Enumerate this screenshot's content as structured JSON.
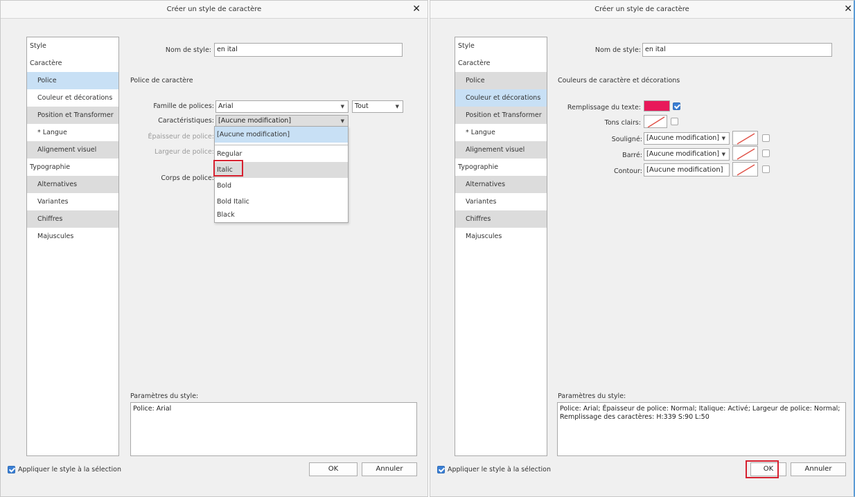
{
  "left_dialog": {
    "title": "Créer un style de caractère",
    "close_glyph": "✕",
    "sidebar": [
      {
        "label": "Style",
        "kind": "header"
      },
      {
        "label": "Caractère",
        "kind": "header"
      },
      {
        "label": "Police",
        "kind": "sub",
        "selected": true
      },
      {
        "label": "Couleur et décorations",
        "kind": "sub"
      },
      {
        "label": "Position et Transformer",
        "kind": "sub"
      },
      {
        "label": "* Langue",
        "kind": "sub"
      },
      {
        "label": "Alignement visuel",
        "kind": "sub"
      },
      {
        "label": "Typographie",
        "kind": "header"
      },
      {
        "label": "Alternatives",
        "kind": "sub"
      },
      {
        "label": "Variantes",
        "kind": "sub"
      },
      {
        "label": "Chiffres",
        "kind": "sub"
      },
      {
        "label": "Majuscules",
        "kind": "sub"
      }
    ],
    "style_name_label": "Nom de style:",
    "style_name_value": "en ital",
    "section_heading": "Police de caractère",
    "font_family_label": "Famille de polices:",
    "font_family_value": "Arial",
    "font_filter_value": "Tout",
    "characteristics_label": "Caractéristiques:",
    "characteristics_value": "[Aucune modification]",
    "weight_label": "Épaisseur de police:",
    "width_label": "Largeur de police:",
    "size_label": "Corps de police:",
    "dropdown_options": [
      "[Aucune modification]",
      "Regular",
      "Italic",
      "Bold",
      "Bold Italic",
      "Black"
    ],
    "dropdown_highlighted": "Italic",
    "params_label": "Paramètres du style:",
    "params_text": "Police: Arial",
    "apply_label": "Appliquer le style à la sélection",
    "ok_label": "OK",
    "cancel_label": "Annuler"
  },
  "right_dialog": {
    "title": "Créer un style de caractère",
    "close_glyph": "✕",
    "sidebar": [
      {
        "label": "Style",
        "kind": "header"
      },
      {
        "label": "Caractère",
        "kind": "header"
      },
      {
        "label": "Police",
        "kind": "sub"
      },
      {
        "label": "Couleur et décorations",
        "kind": "sub",
        "selected": true
      },
      {
        "label": "Position et Transformer",
        "kind": "sub"
      },
      {
        "label": "* Langue",
        "kind": "sub"
      },
      {
        "label": "Alignement visuel",
        "kind": "sub"
      },
      {
        "label": "Typographie",
        "kind": "header"
      },
      {
        "label": "Alternatives",
        "kind": "sub"
      },
      {
        "label": "Variantes",
        "kind": "sub"
      },
      {
        "label": "Chiffres",
        "kind": "sub"
      },
      {
        "label": "Majuscules",
        "kind": "sub"
      }
    ],
    "style_name_label": "Nom de style:",
    "style_name_value": "en ital",
    "section_heading": "Couleurs de caractère et décorations",
    "text_fill_label": "Remplissage du texte:",
    "text_fill_color": "#e8185a",
    "highlight_label": "Tons clairs:",
    "underline_label": "Souligné:",
    "underline_value": "[Aucune modification]",
    "strike_label": "Barré:",
    "strike_value": "[Aucune modification]",
    "outline_label": "Contour:",
    "outline_value": "[Aucune modification]",
    "params_label": "Paramètres du style:",
    "params_text": "Police: Arial; Épaisseur de police: Normal; Italique: Activé; Largeur de police: Normal; Remplissage des caractères: H:339 S:90 L:50",
    "apply_label": "Appliquer le style à la sélection",
    "ok_label": "OK",
    "cancel_label": "Annuler"
  },
  "colors": {
    "selection_blue": "#c8e0f5",
    "highlight_red": "#d6202f",
    "checkbox_blue": "#3b7fd4",
    "no_color_slash": "#e0544a"
  }
}
